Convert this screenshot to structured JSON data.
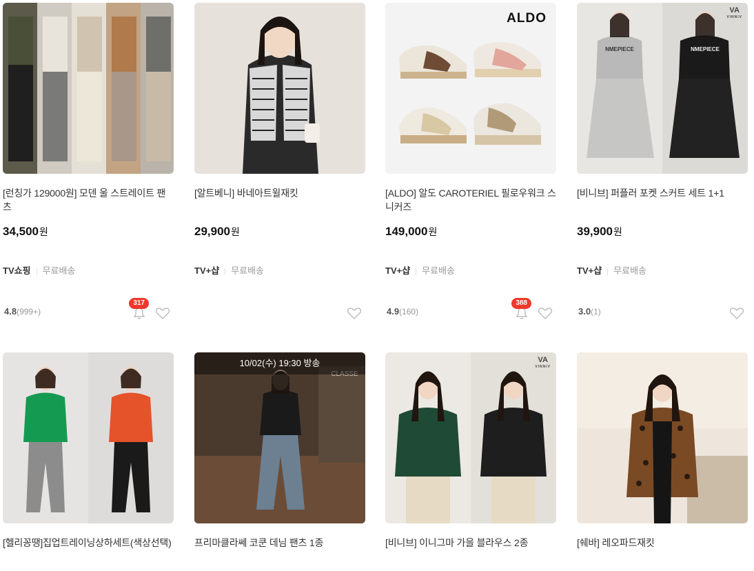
{
  "products": [
    {
      "title": "[런칭가 129000원] 모덴 울 스트레이트 팬츠",
      "price": "34,500",
      "won": "원",
      "brand": "TV쇼핑",
      "shipping": "무료배송",
      "rating": "4.8",
      "rating_count": "(999+)",
      "alarm_count": "317"
    },
    {
      "title": "[알트베니] 바네아트윌재킷",
      "price": "29,900",
      "won": "원",
      "brand": "TV+샵",
      "shipping": "무료배송",
      "rating": "",
      "rating_count": "",
      "alarm_count": ""
    },
    {
      "title": "[ALDO] 알도 CAROTERIEL 필로우워크 스니커즈",
      "price": "149,000",
      "won": "원",
      "brand": "TV+샵",
      "shipping": "무료배송",
      "rating": "4.9",
      "rating_count": "(160)",
      "alarm_count": "388",
      "logo": "ALDO"
    },
    {
      "title": "[비니브] 퍼플러 포켓 스커트 세트 1+1",
      "price": "39,900",
      "won": "원",
      "brand": "TV+샵",
      "shipping": "무료배송",
      "rating": "3.0",
      "rating_count": "(1)",
      "alarm_count": "",
      "logo": "VA",
      "logo_sub": "VINNIV",
      "shirt_text": "NMEPIECE"
    },
    {
      "title": "[헬리꽁땡]집업트레이닝상하세트(색상선택)"
    },
    {
      "title": "프리마클라쎄 코쿤 데님 팬츠 1종",
      "broadcast": "10/02(수) 19:30 방송",
      "sign": "CLASSE"
    },
    {
      "title": "[비니브] 이니그마 가을 블라우스 2종",
      "logo": "VA",
      "logo_sub": "VINNIV"
    },
    {
      "title": "[쉐바] 레오파드재킷"
    }
  ]
}
